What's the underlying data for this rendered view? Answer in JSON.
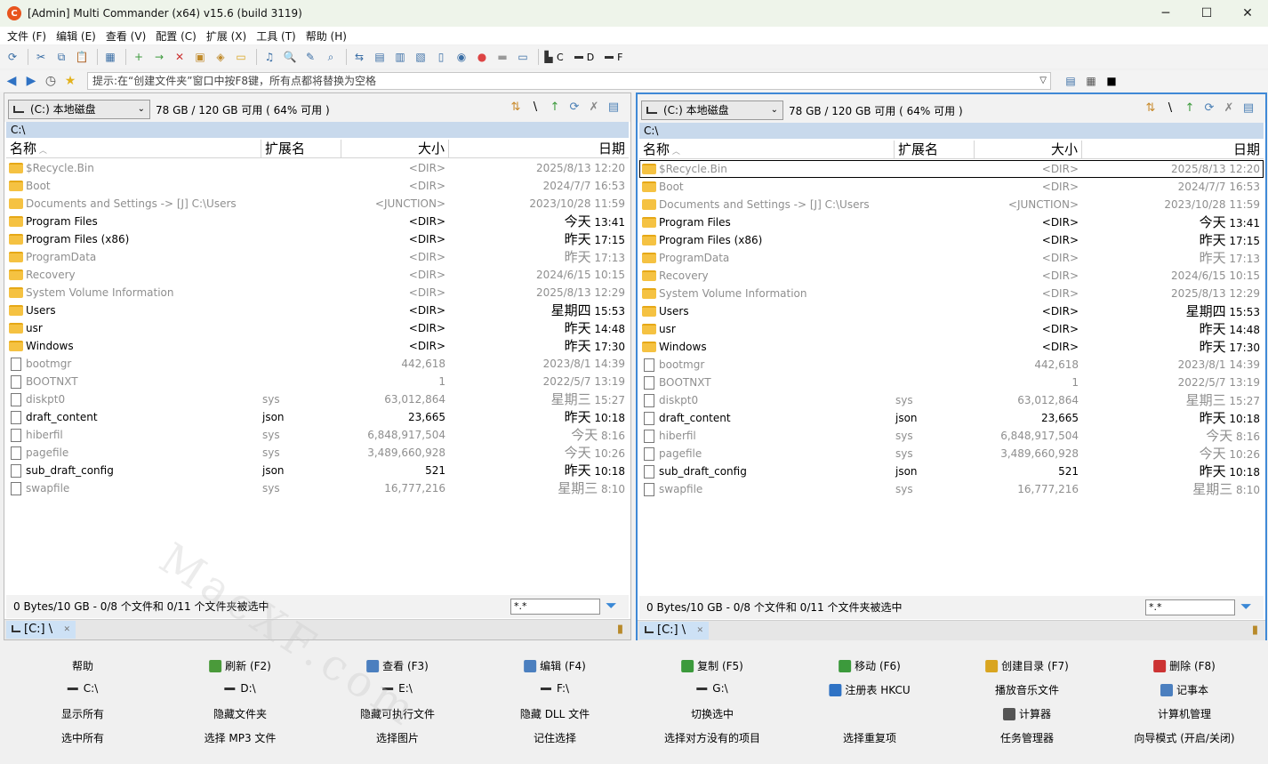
{
  "window": {
    "title": "[Admin] Multi Commander (x64)  v15.6 (build 3119)",
    "minimize": "─",
    "maximize": "☐",
    "close": "✕"
  },
  "menu": [
    "文件 (F)",
    "编辑 (E)",
    "查看 (V)",
    "配置 (C)",
    "扩展 (X)",
    "工具 (T)",
    "帮助 (H)"
  ],
  "toolbar": {
    "drives": [
      "C",
      "D",
      "F"
    ]
  },
  "cmdline": {
    "hint": "提示:在“创建文件夹”窗口中按F8键，所有点都将替换为空格"
  },
  "panels": {
    "left": {
      "drive": "(C:) 本地磁盘",
      "free": "78 GB / 120 GB 可用 ( 64% 可用 )",
      "path": "C:\\",
      "headers": {
        "name": "名称",
        "ext": "扩展名",
        "size": "大小",
        "date": "日期"
      },
      "status": "0 Bytes/10 GB - 0/8 个文件和 0/11 个文件夹被选中",
      "filter": "*.*",
      "tab": "[C:] \\"
    },
    "right": {
      "drive": "(C:) 本地磁盘",
      "free": "78 GB / 120 GB 可用 ( 64% 可用 )",
      "path": "C:\\",
      "headers": {
        "name": "名称",
        "ext": "扩展名",
        "size": "大小",
        "date": "日期"
      },
      "status": "0 Bytes/10 GB - 0/8 个文件和 0/11 个文件夹被选中",
      "filter": "*.*",
      "tab": "[C:] \\"
    }
  },
  "files": [
    {
      "name": "$Recycle.Bin",
      "ext": "",
      "size": "<DIR>",
      "day": "2025/8/13",
      "time": "12:20",
      "type": "folder",
      "dim": true
    },
    {
      "name": "Boot",
      "ext": "",
      "size": "<DIR>",
      "day": "2024/7/7",
      "time": "16:53",
      "type": "folder",
      "dim": true
    },
    {
      "name": "Documents and Settings ->  [J] C:\\Users",
      "ext": "",
      "size": "<JUNCTION>",
      "day": "2023/10/28",
      "time": "11:59",
      "type": "junction",
      "dim": true
    },
    {
      "name": "Program Files",
      "ext": "",
      "size": "<DIR>",
      "day": "今天",
      "time": "13:41",
      "type": "folder",
      "dim": false,
      "big": true
    },
    {
      "name": "Program Files (x86)",
      "ext": "",
      "size": "<DIR>",
      "day": "昨天",
      "time": "17:15",
      "type": "folder",
      "dim": false,
      "big": true
    },
    {
      "name": "ProgramData",
      "ext": "",
      "size": "<DIR>",
      "day": "昨天",
      "time": "17:13",
      "type": "folder",
      "dim": true,
      "big": true
    },
    {
      "name": "Recovery",
      "ext": "",
      "size": "<DIR>",
      "day": "2024/6/15",
      "time": "10:15",
      "type": "folder",
      "dim": true
    },
    {
      "name": "System Volume Information",
      "ext": "",
      "size": "<DIR>",
      "day": "2025/8/13",
      "time": "12:29",
      "type": "folder",
      "dim": true
    },
    {
      "name": "Users",
      "ext": "",
      "size": "<DIR>",
      "day": "星期四",
      "time": "15:53",
      "type": "folder",
      "dim": false,
      "big": true
    },
    {
      "name": "usr",
      "ext": "",
      "size": "<DIR>",
      "day": "昨天",
      "time": "14:48",
      "type": "folder",
      "dim": false,
      "big": true
    },
    {
      "name": "Windows",
      "ext": "",
      "size": "<DIR>",
      "day": "昨天",
      "time": "17:30",
      "type": "folder",
      "dim": false,
      "big": true
    },
    {
      "name": "bootmgr",
      "ext": "",
      "size": "442,618",
      "day": "2023/8/1",
      "time": "14:39",
      "type": "file",
      "dim": true
    },
    {
      "name": "BOOTNXT",
      "ext": "",
      "size": "1",
      "day": "2022/5/7",
      "time": "13:19",
      "type": "file",
      "dim": true
    },
    {
      "name": "diskpt0",
      "ext": "sys",
      "size": "63,012,864",
      "day": "星期三",
      "time": "15:27",
      "type": "file",
      "dim": true,
      "big": true
    },
    {
      "name": "draft_content",
      "ext": "json",
      "size": "23,665",
      "day": "昨天",
      "time": "10:18",
      "type": "file",
      "dim": false,
      "big": true
    },
    {
      "name": "hiberfil",
      "ext": "sys",
      "size": "6,848,917,504",
      "day": "今天",
      "time": "8:16",
      "type": "file",
      "dim": true,
      "big": true
    },
    {
      "name": "pagefile",
      "ext": "sys",
      "size": "3,489,660,928",
      "day": "今天",
      "time": "10:26",
      "type": "file",
      "dim": true,
      "big": true
    },
    {
      "name": "sub_draft_config",
      "ext": "json",
      "size": "521",
      "day": "昨天",
      "time": "10:18",
      "type": "file",
      "dim": false,
      "big": true
    },
    {
      "name": "swapfile",
      "ext": "sys",
      "size": "16,777,216",
      "day": "星期三",
      "time": "8:10",
      "type": "file",
      "dim": true,
      "big": true
    }
  ],
  "fkeys": [
    [
      "帮助",
      "刷新 (F2)",
      "查看 (F3)",
      "编辑 (F4)",
      "复制 (F5)",
      "移动 (F6)",
      "创建目录 (F7)",
      "删除 (F8)"
    ],
    [
      "C:\\",
      "D:\\",
      "E:\\",
      "F:\\",
      "G:\\",
      "注册表 HKCU",
      "播放音乐文件",
      "记事本"
    ],
    [
      "显示所有",
      "隐藏文件夹",
      "隐藏可执行文件",
      "隐藏 DLL 文件",
      "切换选中",
      "",
      "计算器",
      "计算机管理"
    ],
    [
      "选中所有",
      "选择 MP3 文件",
      "选择图片",
      "记住选择",
      "选择对方没有的项目",
      "选择重复项",
      "任务管理器",
      "向导模式 (开启/关闭)"
    ]
  ],
  "watermark": "MacXF.com"
}
